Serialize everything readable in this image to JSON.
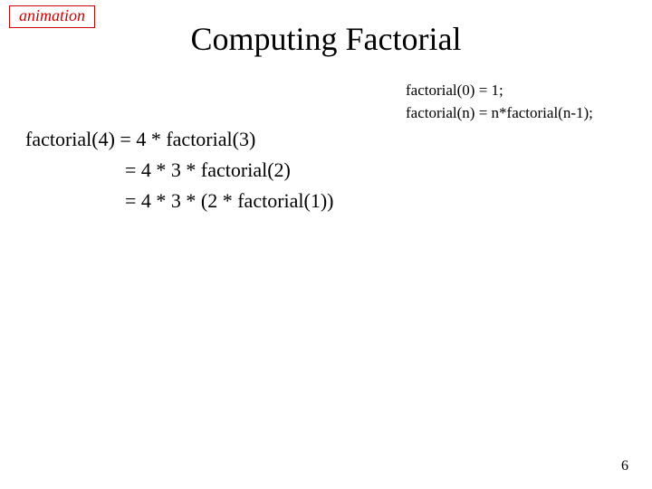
{
  "badge": "animation",
  "title": "Computing Factorial",
  "defs": {
    "line1": "factorial(0) = 1;",
    "line2": "factorial(n) = n*factorial(n-1);"
  },
  "steps": {
    "line1": "factorial(4) = 4 * factorial(3)",
    "line2": "= 4 * 3 * factorial(2)",
    "line3": "= 4 * 3 * (2 * factorial(1))"
  },
  "page_number": "6"
}
